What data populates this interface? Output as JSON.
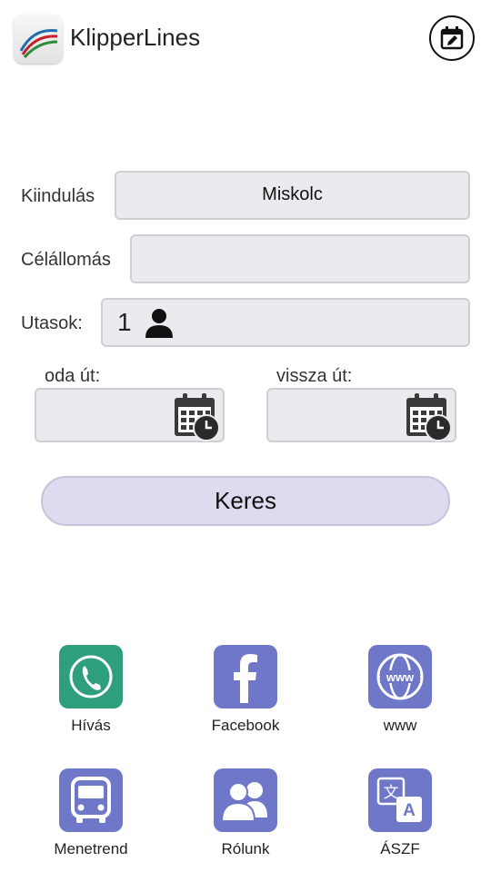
{
  "app": {
    "title": "KlipperLines"
  },
  "form": {
    "from_label": "Kiindulás",
    "from_value": "Miskolc",
    "to_label": "Célállomás",
    "to_value": "",
    "passengers_label": "Utasok:",
    "passengers_count": "1",
    "outbound_label": "oda út:",
    "return_label": "vissza út:",
    "search_label": "Keres"
  },
  "tiles": [
    {
      "label": "Hívás",
      "icon": "phone-icon",
      "color": "#2e9e7c"
    },
    {
      "label": "Facebook",
      "icon": "facebook-icon",
      "color": "#6f78c8"
    },
    {
      "label": "www",
      "icon": "globe-icon",
      "color": "#6f78c8"
    },
    {
      "label": "Menetrend",
      "icon": "bus-icon",
      "color": "#6f78c8"
    },
    {
      "label": "Rólunk",
      "icon": "people-icon",
      "color": "#6f78c8"
    },
    {
      "label": "ÁSZF",
      "icon": "translate-icon",
      "color": "#6f78c8"
    }
  ]
}
